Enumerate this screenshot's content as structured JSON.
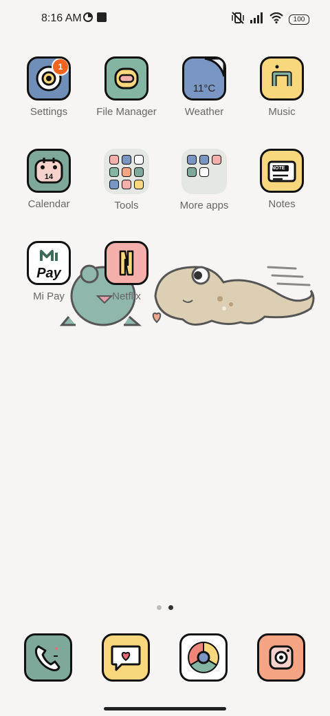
{
  "status_bar": {
    "time": "8:16 AM",
    "battery": "100"
  },
  "apps": [
    {
      "label": "Settings",
      "badge": "1"
    },
    {
      "label": "File Manager"
    },
    {
      "label": "Weather",
      "temp": "11°C"
    },
    {
      "label": "Music"
    },
    {
      "label": "Calendar",
      "day": "14"
    },
    {
      "label": "Tools"
    },
    {
      "label": "More apps"
    },
    {
      "label": "Notes",
      "text": "NOTE"
    },
    {
      "label": "Mi Pay",
      "text": "Pay"
    },
    {
      "label": "Netflix"
    }
  ],
  "page_indicator": {
    "total": 2,
    "active_index": 1
  },
  "dock": [
    "phone",
    "messages",
    "chrome",
    "camera"
  ],
  "colors": {
    "background": "#f6f5f3",
    "badge": "#f06420",
    "settings_bg": "#6f8fb9",
    "file_manager_bg": "#84b4a2",
    "weather_bg": "#7a96c2",
    "music_bg": "#f8d77d",
    "calendar_bg": "#7ea89a",
    "notes_bg": "#f8d77d",
    "netflix_bg": "#f6b0ab",
    "phone_bg": "#7ea89a",
    "messages_bg": "#f8d77d",
    "camera_bg": "#f5a583"
  }
}
